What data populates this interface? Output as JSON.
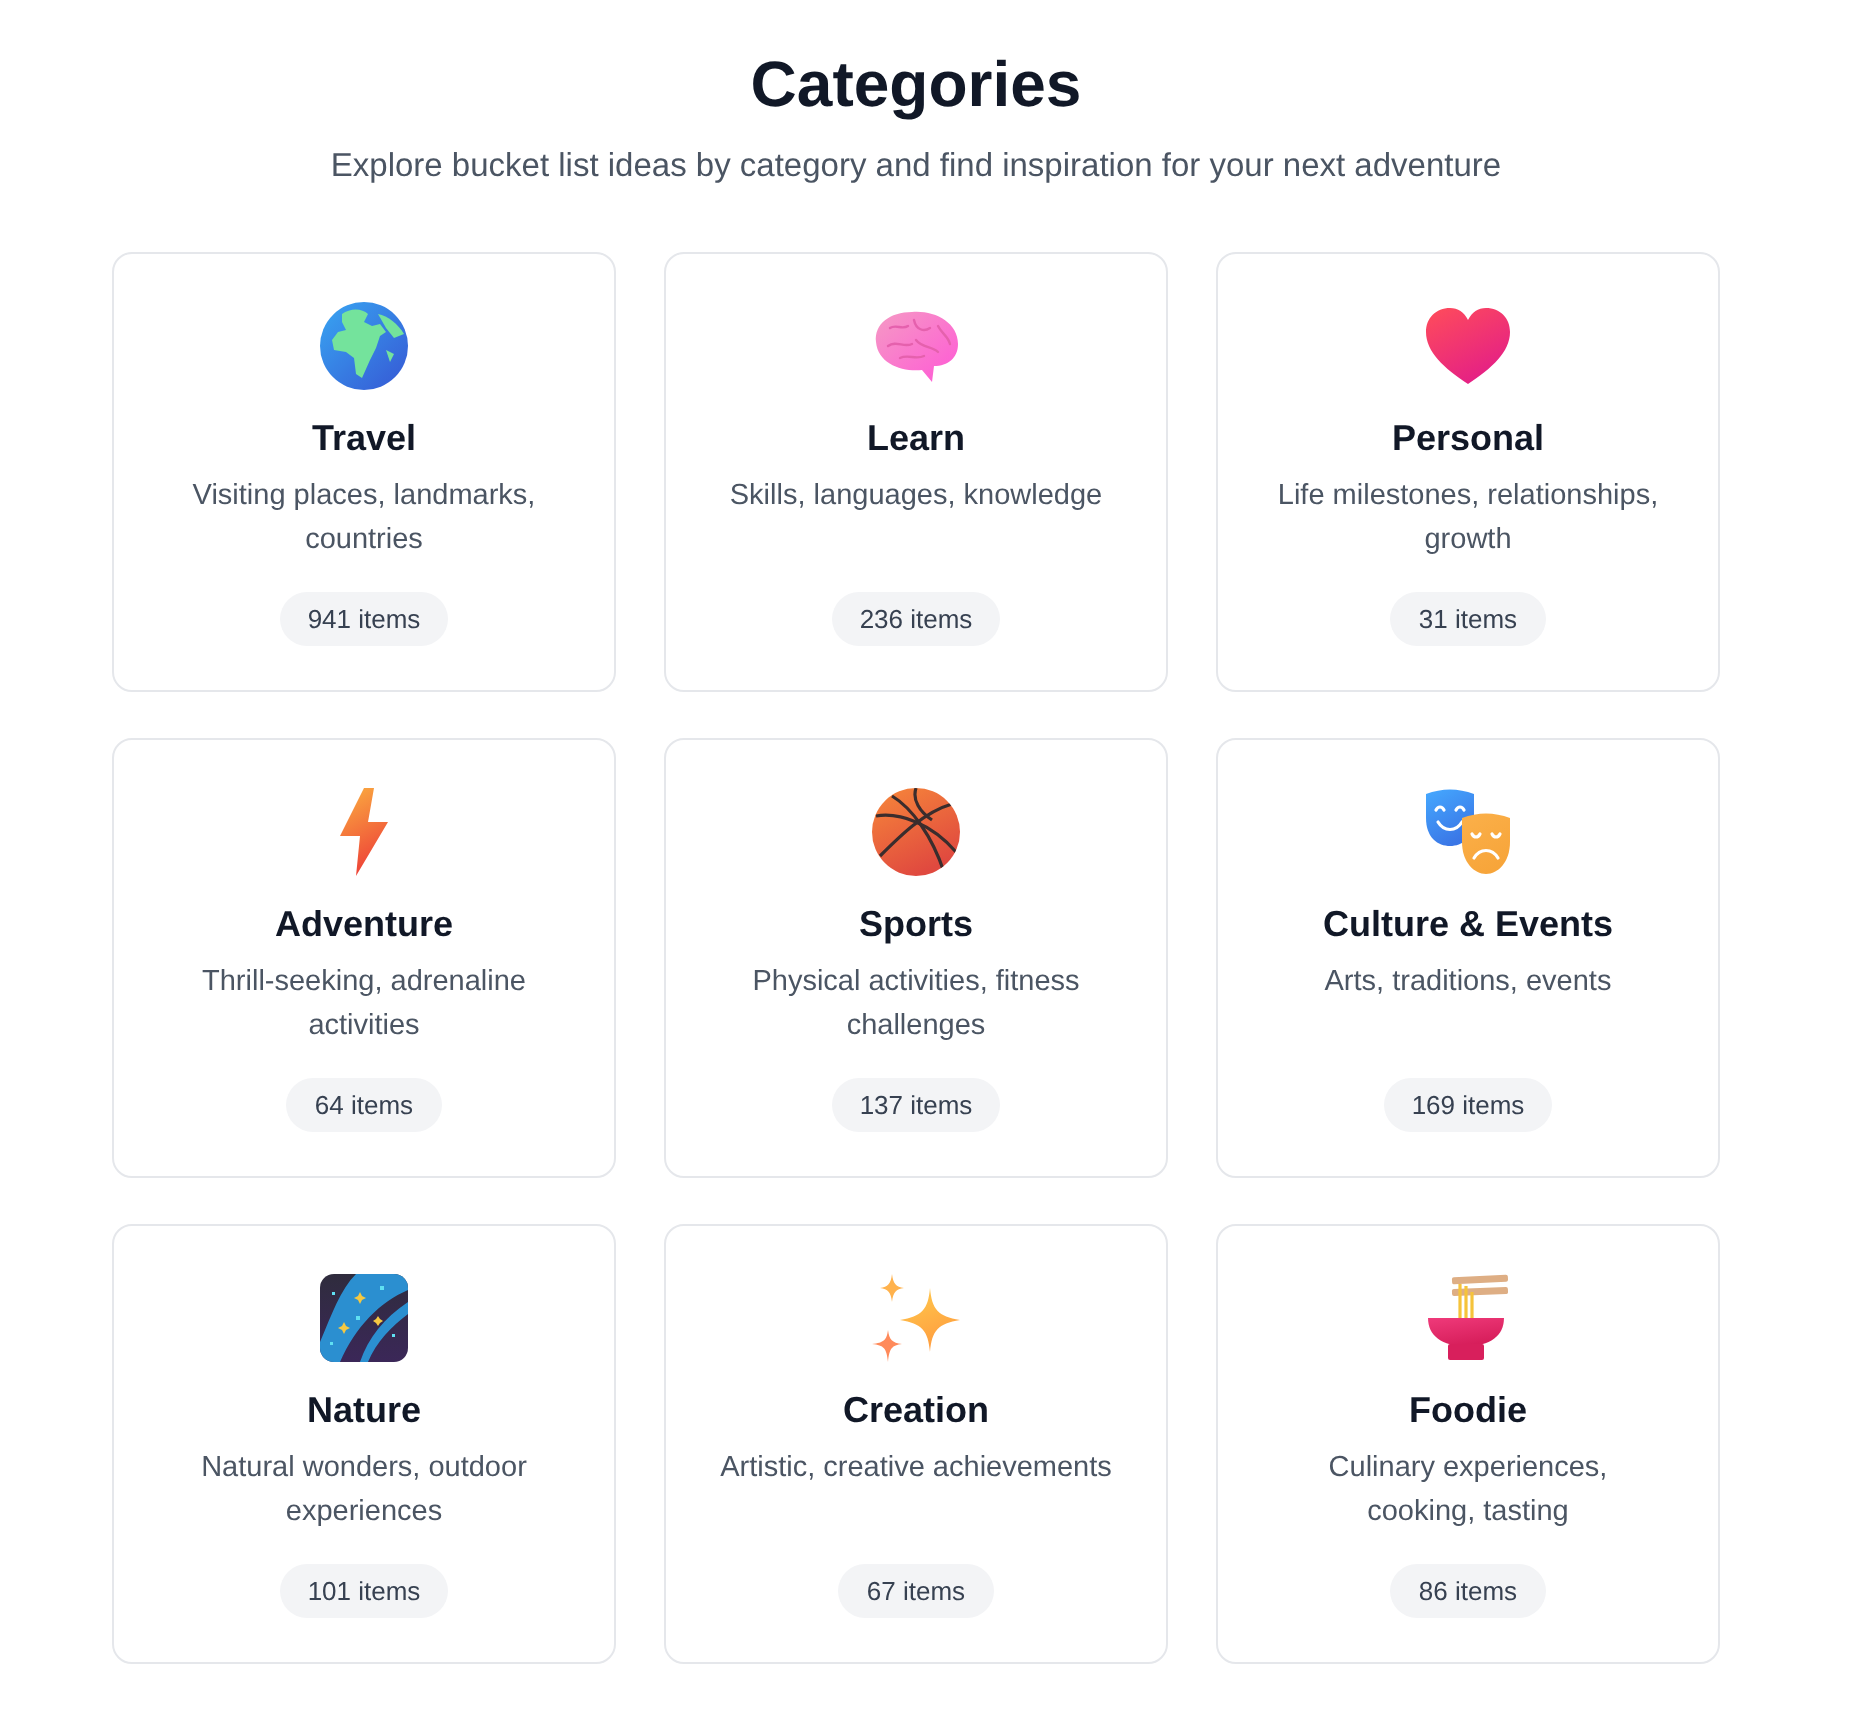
{
  "header": {
    "title": "Categories",
    "subtitle": "Explore bucket list ideas by category and find inspiration for your next adventure"
  },
  "categories": [
    {
      "name": "Travel",
      "description": "Visiting places, landmarks, countries",
      "count": "941 items"
    },
    {
      "name": "Learn",
      "description": "Skills, languages, knowledge",
      "count": "236 items"
    },
    {
      "name": "Personal",
      "description": "Life milestones, relationships, growth",
      "count": "31 items"
    },
    {
      "name": "Adventure",
      "description": "Thrill-seeking, adrenaline activities",
      "count": "64 items"
    },
    {
      "name": "Sports",
      "description": "Physical activities, fitness challenges",
      "count": "137 items"
    },
    {
      "name": "Culture & Events",
      "description": "Arts, traditions, events",
      "count": "169 items"
    },
    {
      "name": "Nature",
      "description": "Natural wonders, outdoor experiences",
      "count": "101 items"
    },
    {
      "name": "Creation",
      "description": "Artistic, creative achievements",
      "count": "67 items"
    },
    {
      "name": "Foodie",
      "description": "Culinary experiences, cooking, tasting",
      "count": "86 items"
    }
  ]
}
